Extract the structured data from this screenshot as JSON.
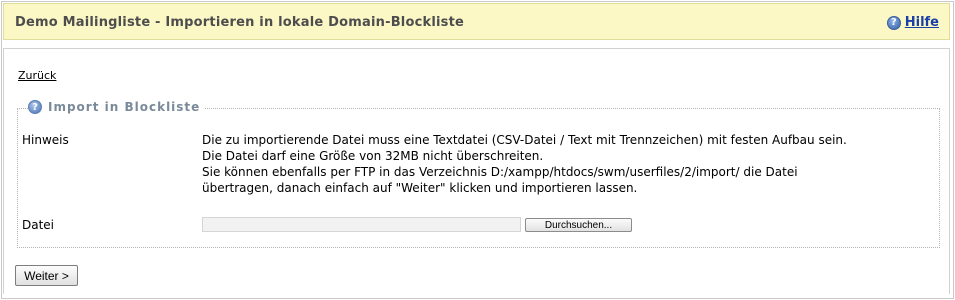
{
  "header": {
    "title": "Demo Mailingliste - Importieren in lokale Domain-Blockliste",
    "help_icon": "help-circle-icon",
    "help_label": "Hilfe"
  },
  "nav": {
    "back_label": "Zurück"
  },
  "section": {
    "legend_icon": "help-circle-icon",
    "legend": "Import in Blockliste",
    "hint_label": "Hinweis",
    "hint_lines": [
      "Die zu importierende Datei muss eine Textdatei (CSV-Datei / Text mit Trennzeichen) mit festen Aufbau sein.",
      "Die Datei darf eine Größe von 32MB nicht überschreiten.",
      "Sie können ebenfalls per FTP in das Verzeichnis D:/xampp/htdocs/swm/userfiles/2/import/ die Datei",
      "übertragen, danach einfach auf \"Weiter\" klicken und importieren lassen."
    ],
    "file_label": "Datei",
    "file_value": "",
    "browse_label": "Durchsuchen..."
  },
  "actions": {
    "next_label": "Weiter >"
  },
  "colors": {
    "header_bg": "#fcf8c6",
    "help_link": "#1a3fa6",
    "legend_text": "#7a8a99"
  }
}
